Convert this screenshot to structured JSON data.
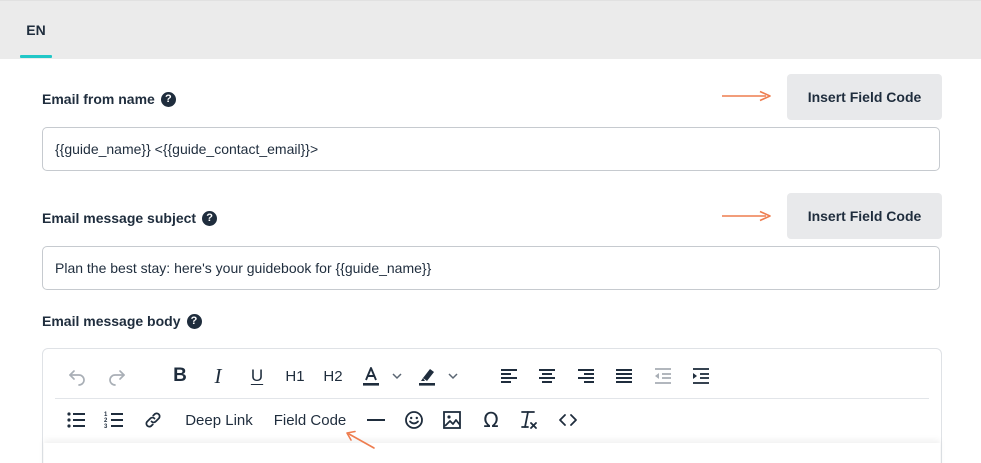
{
  "language_tab": {
    "label": "EN",
    "accent_color": "#21c7c7"
  },
  "fields": {
    "from_name": {
      "label": "Email from name",
      "value": "{{guide_name}} <{{guide_contact_email}}>",
      "insert_button": "Insert Field Code"
    },
    "subject": {
      "label": "Email message subject",
      "value": "Plan the best stay: here's your guidebook for {{guide_name}}",
      "insert_button": "Insert Field Code"
    },
    "body": {
      "label": "Email message body"
    }
  },
  "help_icon_glyph": "?",
  "annotation_arrow_color": "#ee7d4f",
  "toolbar": {
    "row1": [
      {
        "icon": "undo-icon"
      },
      {
        "icon": "redo-icon"
      },
      {
        "icon": "bold-icon"
      },
      {
        "icon": "italic-icon"
      },
      {
        "icon": "underline-icon"
      },
      {
        "label": "H1"
      },
      {
        "label": "H2"
      },
      {
        "icon": "text-color-icon"
      },
      {
        "icon": "chevron-down-icon"
      },
      {
        "icon": "highlight-icon"
      },
      {
        "icon": "chevron-down-icon"
      },
      {
        "icon": "align-left-icon"
      },
      {
        "icon": "align-center-icon"
      },
      {
        "icon": "align-right-icon"
      },
      {
        "icon": "align-justify-icon"
      },
      {
        "icon": "outdent-icon"
      },
      {
        "icon": "indent-icon"
      }
    ],
    "row2": [
      {
        "icon": "bullet-list-icon"
      },
      {
        "icon": "numbered-list-icon"
      },
      {
        "icon": "link-icon"
      },
      {
        "label": "Deep Link"
      },
      {
        "label": "Field Code"
      },
      {
        "icon": "horizontal-rule-icon"
      },
      {
        "icon": "emoji-icon"
      },
      {
        "icon": "image-icon"
      },
      {
        "icon": "special-character-icon"
      },
      {
        "icon": "clear-format-icon"
      },
      {
        "icon": "source-code-icon"
      }
    ],
    "h1_label": "H1",
    "h2_label": "H2",
    "deep_link_label": "Deep Link",
    "field_code_label": "Field Code",
    "omega_glyph": "Ω"
  }
}
